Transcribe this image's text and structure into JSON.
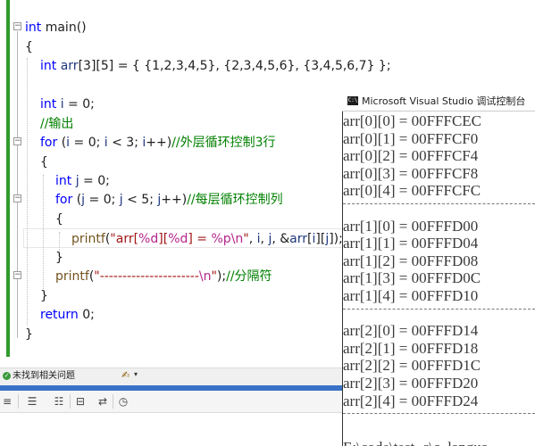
{
  "editor": {
    "lines": [
      {
        "tokens": [
          {
            "t": "int",
            "c": "kw"
          },
          {
            "t": " main()",
            "c": ""
          }
        ]
      },
      {
        "tokens": [
          {
            "t": "{",
            "c": ""
          }
        ]
      },
      {
        "tokens": [
          {
            "t": "int",
            "c": "kw"
          },
          {
            "t": " ",
            "c": ""
          },
          {
            "t": "arr",
            "c": "var"
          },
          {
            "t": "[3][5] = { {1,2,3,4,5}, {2,3,4,5,6}, {3,4,5,6,7} };",
            "c": ""
          }
        ]
      },
      {
        "tokens": [
          {
            "t": "",
            "c": ""
          }
        ]
      },
      {
        "tokens": [
          {
            "t": "int",
            "c": "kw"
          },
          {
            "t": " ",
            "c": ""
          },
          {
            "t": "i",
            "c": "var"
          },
          {
            "t": " = 0;",
            "c": ""
          }
        ]
      },
      {
        "tokens": [
          {
            "t": "//输出",
            "c": "cmt"
          }
        ]
      },
      {
        "tokens": [
          {
            "t": "for",
            "c": "kw"
          },
          {
            "t": " (",
            "c": ""
          },
          {
            "t": "i",
            "c": "var"
          },
          {
            "t": " = 0; ",
            "c": ""
          },
          {
            "t": "i",
            "c": "var"
          },
          {
            "t": " < 3; ",
            "c": ""
          },
          {
            "t": "i",
            "c": "var"
          },
          {
            "t": "++)",
            "c": ""
          },
          {
            "t": "//外层循环控制3行",
            "c": "cmt"
          }
        ]
      },
      {
        "tokens": [
          {
            "t": "{",
            "c": ""
          }
        ]
      },
      {
        "tokens": [
          {
            "t": "int",
            "c": "kw"
          },
          {
            "t": " ",
            "c": ""
          },
          {
            "t": "j",
            "c": "var"
          },
          {
            "t": " = 0;",
            "c": ""
          }
        ]
      },
      {
        "tokens": [
          {
            "t": "for",
            "c": "kw"
          },
          {
            "t": " (",
            "c": ""
          },
          {
            "t": "j",
            "c": "var"
          },
          {
            "t": " = 0; ",
            "c": ""
          },
          {
            "t": "j",
            "c": "var"
          },
          {
            "t": " < 5; ",
            "c": ""
          },
          {
            "t": "j",
            "c": "var"
          },
          {
            "t": "++)",
            "c": ""
          },
          {
            "t": "//每层循环控制列",
            "c": "cmt"
          }
        ]
      },
      {
        "tokens": [
          {
            "t": "{",
            "c": ""
          }
        ]
      },
      {
        "tokens": [
          {
            "t": "printf",
            "c": "fn"
          },
          {
            "t": "(",
            "c": ""
          },
          {
            "t": "\"arr[",
            "c": "str"
          },
          {
            "t": "%d",
            "c": "fmt"
          },
          {
            "t": "][",
            "c": "str"
          },
          {
            "t": "%d",
            "c": "fmt"
          },
          {
            "t": "] = ",
            "c": "str"
          },
          {
            "t": "%p",
            "c": "fmt"
          },
          {
            "t": "\\n",
            "c": "fmt"
          },
          {
            "t": "\"",
            "c": "str"
          },
          {
            "t": ", ",
            "c": ""
          },
          {
            "t": "i",
            "c": "var"
          },
          {
            "t": ", ",
            "c": ""
          },
          {
            "t": "j",
            "c": "var"
          },
          {
            "t": ", &",
            "c": ""
          },
          {
            "t": "arr",
            "c": "var"
          },
          {
            "t": "[",
            "c": ""
          },
          {
            "t": "i",
            "c": "var"
          },
          {
            "t": "][",
            "c": ""
          },
          {
            "t": "j",
            "c": "var"
          },
          {
            "t": "]);",
            "c": ""
          }
        ]
      },
      {
        "tokens": [
          {
            "t": "}",
            "c": ""
          }
        ]
      },
      {
        "tokens": [
          {
            "t": "printf",
            "c": "fn"
          },
          {
            "t": "(",
            "c": ""
          },
          {
            "t": "\"----------------------",
            "c": "str"
          },
          {
            "t": "\\n",
            "c": "fmt"
          },
          {
            "t": "\"",
            "c": "str"
          },
          {
            "t": ");",
            "c": ""
          },
          {
            "t": "//分隔符",
            "c": "cmt"
          }
        ]
      },
      {
        "tokens": [
          {
            "t": "}",
            "c": ""
          }
        ]
      },
      {
        "tokens": [
          {
            "t": "return",
            "c": "kw"
          },
          {
            "t": " 0;",
            "c": ""
          }
        ]
      },
      {
        "tokens": [
          {
            "t": "}",
            "c": ""
          }
        ]
      }
    ]
  },
  "status": {
    "ok_icon": "check-icon",
    "text": "未找到相关问题",
    "brush_icon": "brush-icon"
  },
  "console": {
    "icon_text": "C:\\",
    "title": "Microsoft Visual Studio 调试控制台",
    "groups": [
      [
        "arr[0][0] = 00FFFCEC",
        "arr[0][1] = 00FFFCF0",
        "arr[0][2] = 00FFFCF4",
        "arr[0][3] = 00FFFCF8",
        "arr[0][4] = 00FFFCFC"
      ],
      [
        "arr[1][0] = 00FFFD00",
        "arr[1][1] = 00FFFD04",
        "arr[1][2] = 00FFFD08",
        "arr[1][3] = 00FFFD0C",
        "arr[1][4] = 00FFFD10"
      ],
      [
        "arr[2][0] = 00FFFD14",
        "arr[2][1] = 00FFFD18",
        "arr[2][2] = 00FFFD1C",
        "arr[2][3] = 00FFFD20",
        "arr[2][4] = 00FFFD24"
      ]
    ],
    "prompt": "E:\\code\\test_c\\c_langua"
  },
  "colors": {
    "keyword": "#0000ff",
    "comment": "#008000",
    "string": "#a31515",
    "format": "#b5258b",
    "edge_bar": "#2e9b2e",
    "panel_accent": "#3a72c8"
  }
}
